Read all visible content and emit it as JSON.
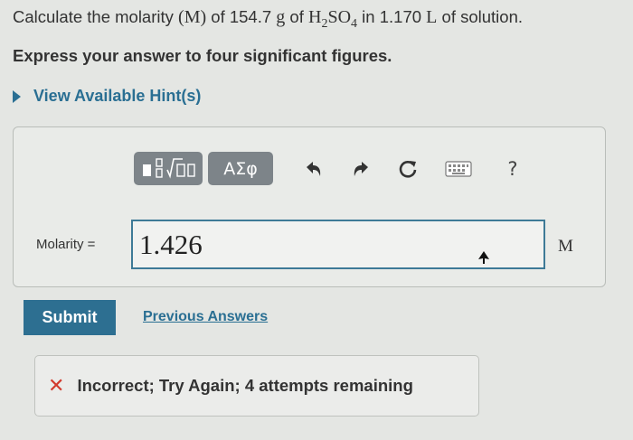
{
  "question": {
    "prefix": "Calculate the molarity ",
    "m_symbol": "(M)",
    "mid": " of 154.7 ",
    "g_unit": "g",
    "of_word": " of ",
    "formula_h": "H",
    "formula_h_sub": "2",
    "formula_so": "SO",
    "formula_o_sub": "4",
    "in_part": " in 1.170 ",
    "l_unit": "L",
    "suffix": " of solution."
  },
  "instruction": "Express your answer to four significant figures.",
  "hint_link": "View Available Hint(s)",
  "toolbar": {
    "greek_label": "ΑΣφ",
    "help_label": "?"
  },
  "answer": {
    "label": "Molarity =",
    "value": "1.426",
    "unit": "M"
  },
  "submit_label": "Submit",
  "previous_answers_label": "Previous Answers",
  "feedback": {
    "icon": "✕",
    "text": "Incorrect; Try Again; 4 attempts remaining"
  },
  "colors": {
    "accent": "#2d6f91",
    "error": "#d23a2d",
    "toolbar_button": "#7d8489"
  }
}
